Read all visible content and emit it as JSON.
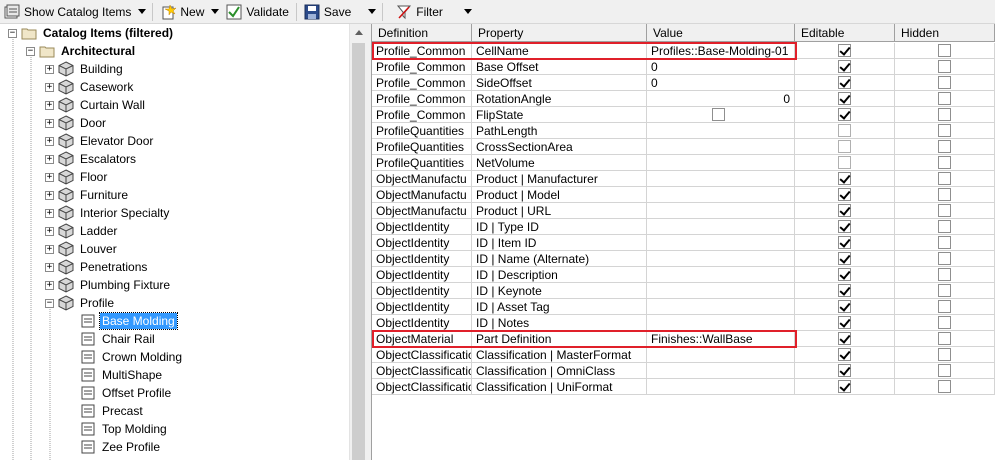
{
  "toolbar": {
    "show_catalog_items": "Show Catalog Items",
    "new": "New",
    "validate": "Validate",
    "save": "Save",
    "filter": "Filter"
  },
  "tree": {
    "root": "Catalog Items (filtered)",
    "architectural": "Architectural",
    "categories": [
      "Building",
      "Casework",
      "Curtain Wall",
      "Door",
      "Elevator Door",
      "Escalators",
      "Floor",
      "Furniture",
      "Interior Specialty",
      "Ladder",
      "Louver",
      "Penetrations",
      "Plumbing Fixture"
    ],
    "profile": "Profile",
    "profile_items": [
      "Base Molding",
      "Chair Rail",
      "Crown Molding",
      "MultiShape",
      "Offset Profile",
      "Precast",
      "Top Molding",
      "Zee Profile"
    ],
    "selected_item": "Base Molding"
  },
  "grid": {
    "columns": [
      "Definition",
      "Property",
      "Value",
      "Editable",
      "Hidden"
    ],
    "rows": [
      {
        "definition": "Profile_Common",
        "property": "CellName",
        "value": "Profiles::Base-Molding-01",
        "editable": true,
        "hidden": false
      },
      {
        "definition": "Profile_Common",
        "property": "Base Offset",
        "value": "0",
        "editable": true,
        "hidden": false
      },
      {
        "definition": "Profile_Common",
        "property": "SideOffset",
        "value": "0",
        "editable": true,
        "hidden": false
      },
      {
        "definition": "Profile_Common",
        "property": "RotationAngle",
        "value": "0",
        "editable": true,
        "hidden": false
      },
      {
        "definition": "Profile_Common",
        "property": "FlipState",
        "value": "",
        "editable": true,
        "hidden": false
      },
      {
        "definition": "ProfileQuantities",
        "property": "PathLength",
        "value": "",
        "editable": false,
        "hidden": false
      },
      {
        "definition": "ProfileQuantities",
        "property": "CrossSectionArea",
        "value": "",
        "editable": false,
        "hidden": false
      },
      {
        "definition": "ProfileQuantities",
        "property": "NetVolume",
        "value": "",
        "editable": false,
        "hidden": false
      },
      {
        "definition": "ObjectManufactu",
        "property": "Product | Manufacturer",
        "value": "",
        "editable": true,
        "hidden": false
      },
      {
        "definition": "ObjectManufactu",
        "property": "Product | Model",
        "value": "",
        "editable": true,
        "hidden": false
      },
      {
        "definition": "ObjectManufactu",
        "property": "Product | URL",
        "value": "",
        "editable": true,
        "hidden": false
      },
      {
        "definition": "ObjectIdentity",
        "property": "ID | Type ID",
        "value": "",
        "editable": true,
        "hidden": false
      },
      {
        "definition": "ObjectIdentity",
        "property": "ID | Item ID",
        "value": "",
        "editable": true,
        "hidden": false
      },
      {
        "definition": "ObjectIdentity",
        "property": "ID | Name (Alternate)",
        "value": "",
        "editable": true,
        "hidden": false
      },
      {
        "definition": "ObjectIdentity",
        "property": "ID | Description",
        "value": "",
        "editable": true,
        "hidden": false
      },
      {
        "definition": "ObjectIdentity",
        "property": "ID | Keynote",
        "value": "",
        "editable": true,
        "hidden": false
      },
      {
        "definition": "ObjectIdentity",
        "property": "ID | Asset Tag",
        "value": "",
        "editable": true,
        "hidden": false
      },
      {
        "definition": "ObjectIdentity",
        "property": "ID | Notes",
        "value": "",
        "editable": true,
        "hidden": false
      },
      {
        "definition": "ObjectMaterial",
        "property": "Part Definition",
        "value": "Finishes::WallBase",
        "editable": true,
        "hidden": false
      },
      {
        "definition": "ObjectClassificatio",
        "property": "Classification | MasterFormat",
        "value": "",
        "editable": true,
        "hidden": false
      },
      {
        "definition": "ObjectClassificatio",
        "property": "Classification | OmniClass",
        "value": "",
        "editable": true,
        "hidden": false
      },
      {
        "definition": "ObjectClassificatio",
        "property": "Classification | UniFormat",
        "value": "",
        "editable": true,
        "hidden": false
      }
    ]
  },
  "colors": {
    "highlight": "#e0202a",
    "selection": "#3399ff"
  }
}
